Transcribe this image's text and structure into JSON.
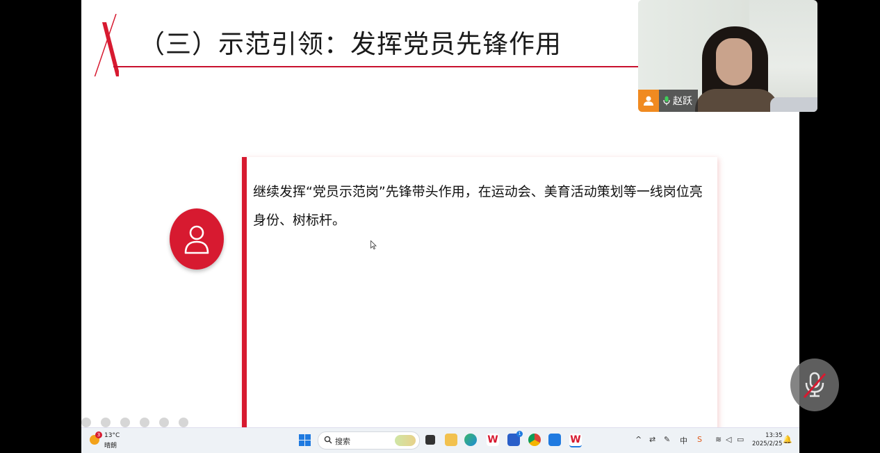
{
  "slide": {
    "title": "（三）示范引领：发挥党员先锋作用",
    "body_text": "继续发挥“党员示范岗”先锋带头作用，在运动会、美育活动策划等一线岗位亮身份、树标杆。"
  },
  "video": {
    "participant_name": "赵跃"
  },
  "taskbar": {
    "weather_badge": "3",
    "weather_temp": "13°C",
    "weather_condition": "晴朗",
    "search_placeholder": "搜索",
    "store_badge": "1",
    "clock_time": "13:35",
    "clock_date": "2025/2/25"
  },
  "colors": {
    "accent_red": "#d71a30",
    "camera_badge_orange": "#f08a20",
    "windows_blue": "#1f7ae0"
  }
}
